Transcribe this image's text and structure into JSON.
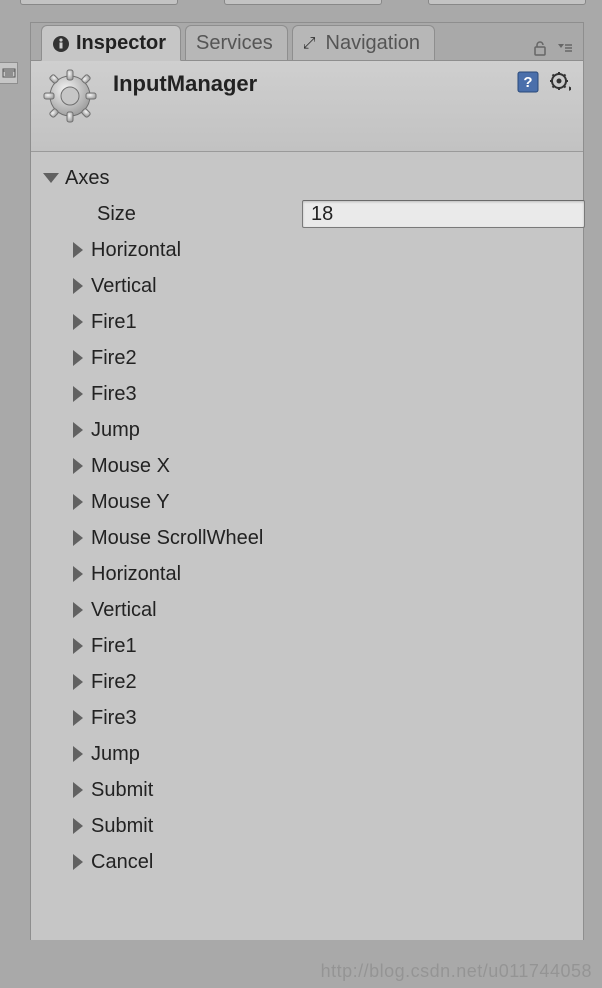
{
  "tabs": {
    "inspector": "Inspector",
    "services": "Services",
    "navigation": "Navigation"
  },
  "header": {
    "title": "InputManager"
  },
  "axes": {
    "label": "Axes",
    "size_label": "Size",
    "size_value": "18",
    "items": [
      "Horizontal",
      "Vertical",
      "Fire1",
      "Fire2",
      "Fire3",
      "Jump",
      "Mouse X",
      "Mouse Y",
      "Mouse ScrollWheel",
      "Horizontal",
      "Vertical",
      "Fire1",
      "Fire2",
      "Fire3",
      "Jump",
      "Submit",
      "Submit",
      "Cancel"
    ]
  },
  "watermark": "http://blog.csdn.net/u011744058"
}
